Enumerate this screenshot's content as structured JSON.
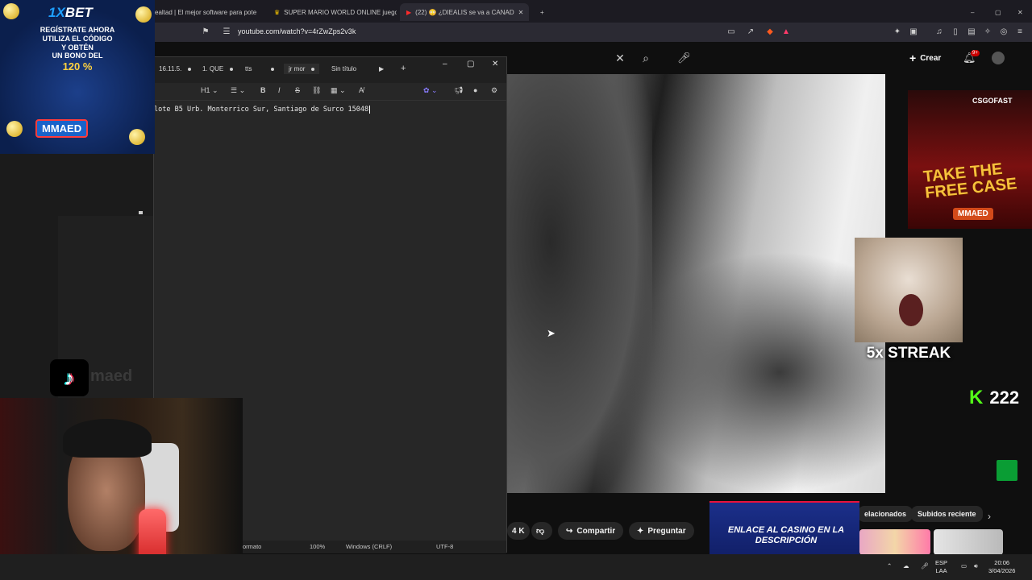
{
  "browser": {
    "tabs": [
      {
        "label": "ealtad | El mejor software para pote"
      },
      {
        "label": "SUPER MARIO WORLD ONLINE juego"
      },
      {
        "label": "(22) 😳 ¿DIEALIS se va a CANAD"
      }
    ],
    "url": "youtube.com/watch?v=4rZwZps2v3k"
  },
  "youtube": {
    "create_label": "Crear",
    "notif_badge": "9+",
    "actions": {
      "likes": "4 K",
      "share": "Compartir",
      "ask": "Preguntar"
    },
    "chips": [
      "elacionados",
      "Subidos reciente"
    ]
  },
  "notepad": {
    "tabs": [
      "16.11.5.",
      "1. QUE",
      "tts",
      "jr mor",
      "Sin título"
    ],
    "toolbar": {
      "heading": "H1"
    },
    "text": "lote B5 Urb. Monterrico Sur, Santiago de Surco 15048",
    "status": {
      "format": "ormato",
      "zoom": "100%",
      "eol": "Windows (CRLF)",
      "encoding": "UTF-8"
    }
  },
  "overlays": {
    "ad_1xbet": {
      "logo_prefix": "1X",
      "logo_suffix": "BET",
      "promo_lines": [
        "REGÍSTRATE AHORA",
        "UTILIZA EL CÓDIGO",
        "Y OBTÉN",
        "UN BONO DEL"
      ],
      "bonus": "120 %",
      "code": "MMAED"
    },
    "csgo": {
      "brand": "CSGOFAST",
      "headline_1": "TAKE THE",
      "headline_2": "FREE CASE",
      "code": "MMAED"
    },
    "streak": "5x STREAK",
    "kick": {
      "logo": "K",
      "count": "222"
    },
    "tiktok_handle": "maed",
    "casino": "ENLACE AL CASINO EN LA DESCRIPCIÓN"
  },
  "taskbar": {
    "lang": "ESP",
    "layout": "LAA",
    "time": "20:06",
    "date": "3/04/2026"
  }
}
